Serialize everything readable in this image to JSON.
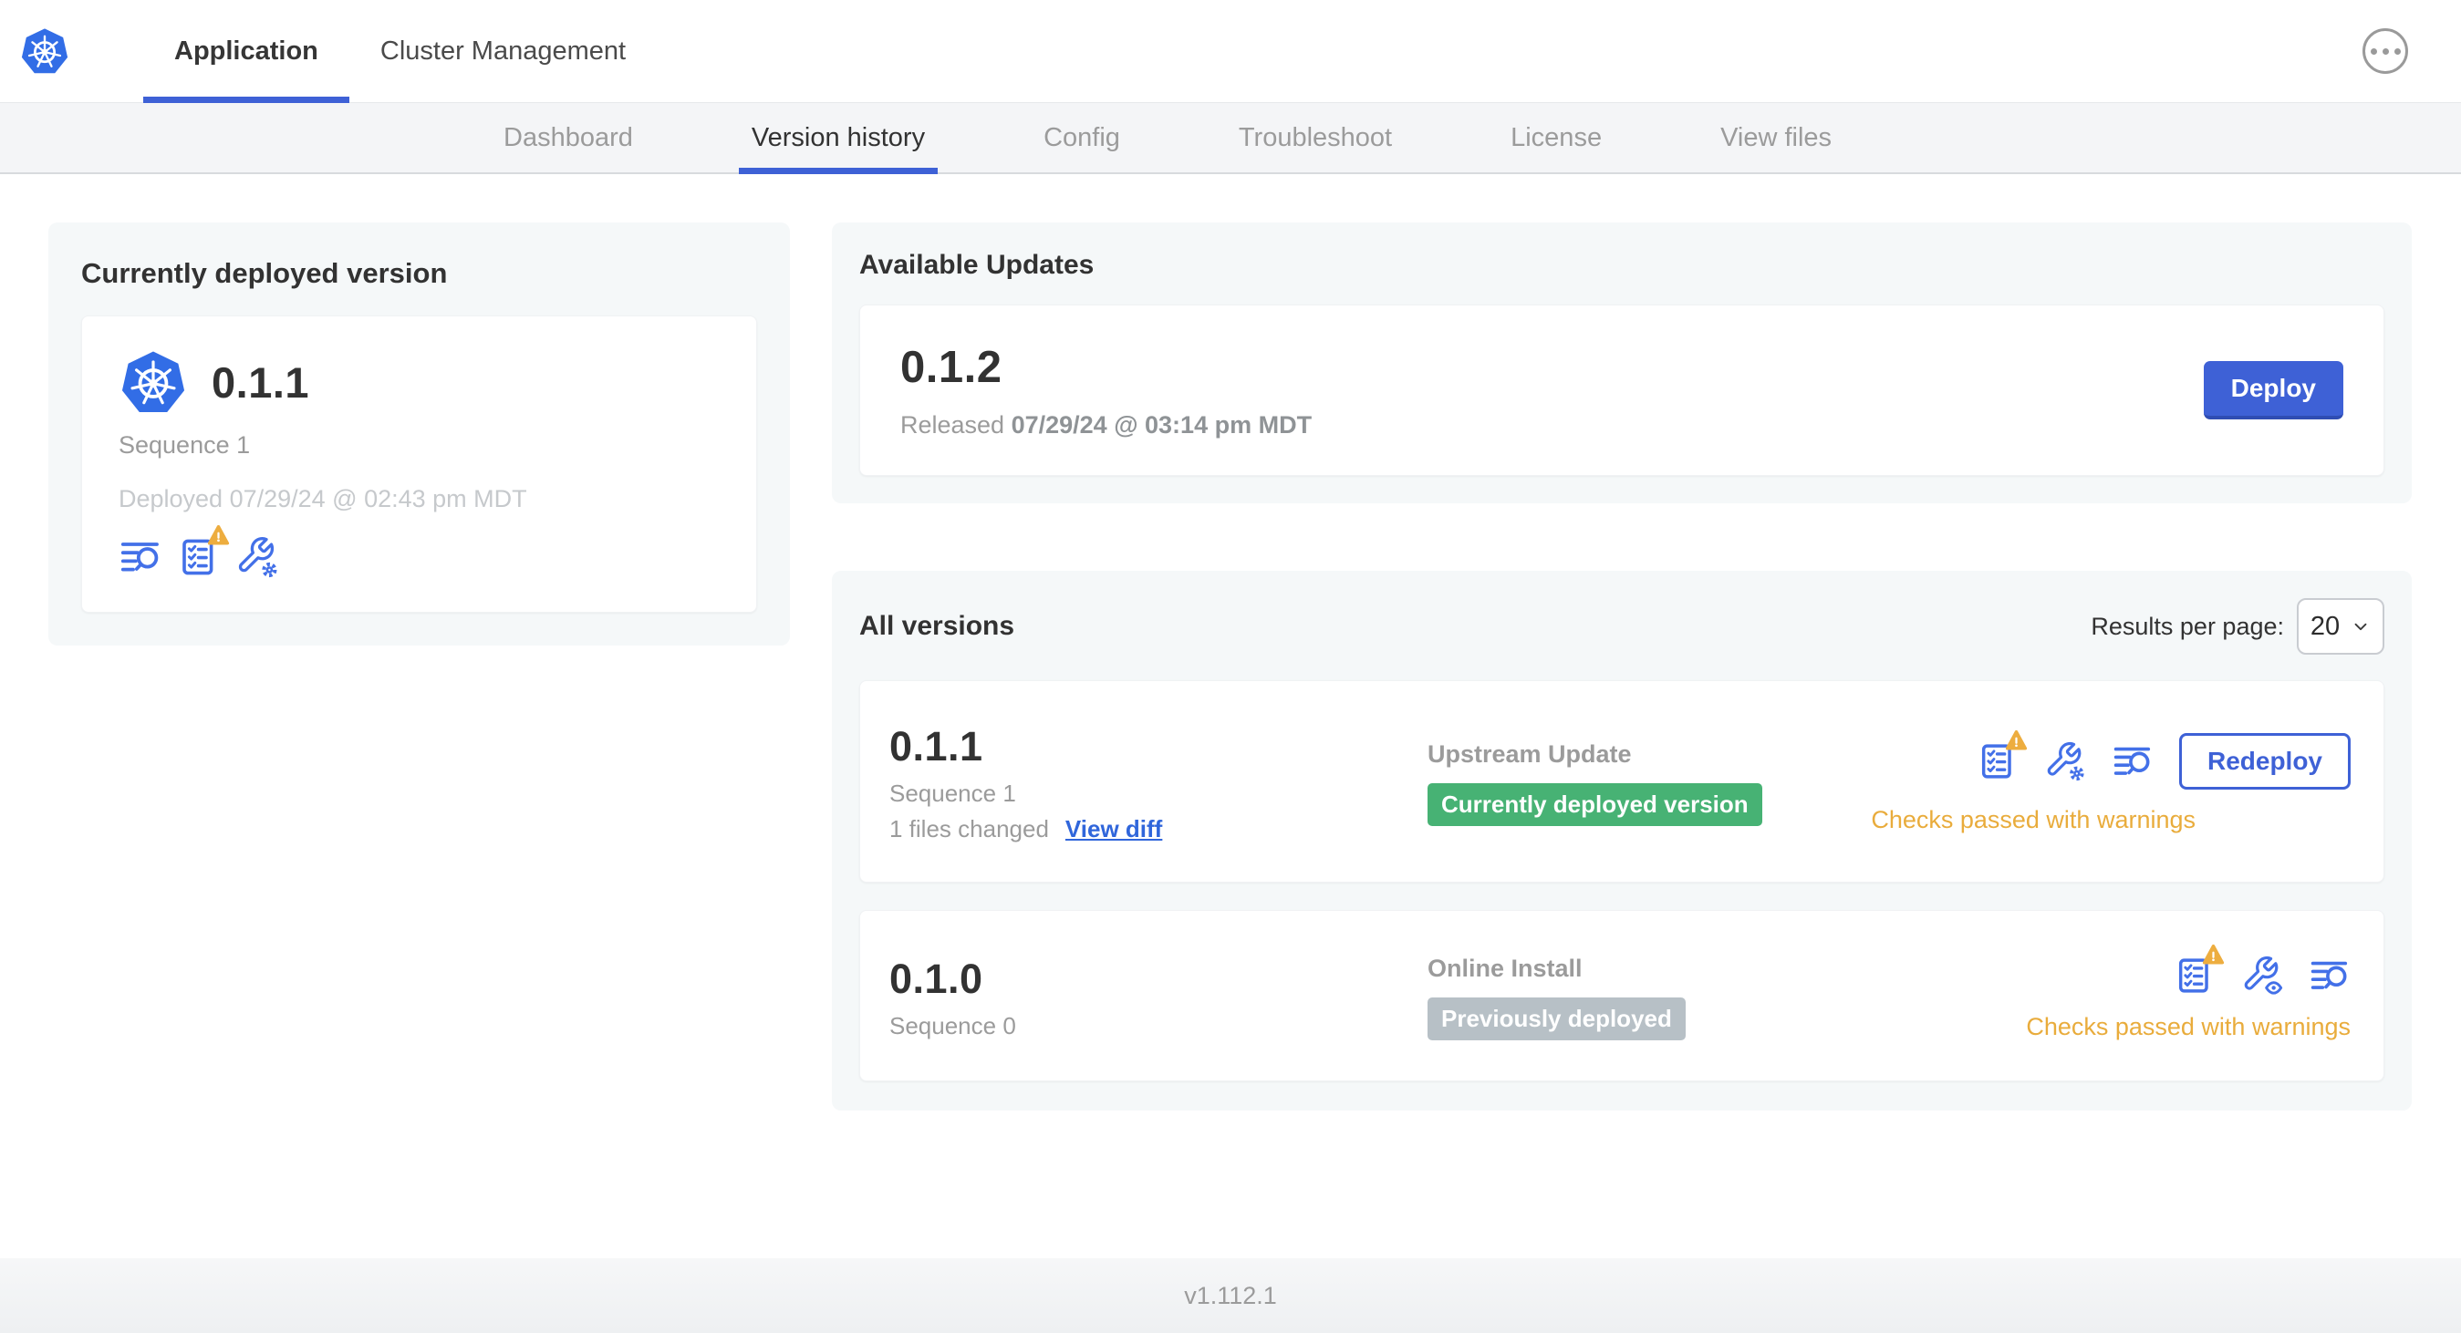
{
  "colors": {
    "kubernetes_blue": "#326DE6",
    "accent_blue": "#3E61D6",
    "icon_blue": "#4370E8",
    "link_blue": "#3066DB",
    "success_green": "#47B274",
    "muted_badge_gray": "#B7C0C6",
    "warning_orange": "#E9AC3C",
    "text_dark": "#323232",
    "text_gray": "#9B9B9B",
    "text_light_gray": "#C6C9CC"
  },
  "header": {
    "logo_icon": "kubernetes-logo",
    "tabs": [
      {
        "label": "Application",
        "active": true
      },
      {
        "label": "Cluster Management",
        "active": false
      }
    ],
    "more_icon": "ellipsis-icon"
  },
  "subnav": {
    "items": [
      {
        "label": "Dashboard",
        "active": false
      },
      {
        "label": "Version history",
        "active": true
      },
      {
        "label": "Config",
        "active": false
      },
      {
        "label": "Troubleshoot",
        "active": false
      },
      {
        "label": "License",
        "active": false
      },
      {
        "label": "View files",
        "active": false
      }
    ]
  },
  "current_version": {
    "title": "Currently deployed version",
    "version": "0.1.1",
    "sequence": "Sequence 1",
    "deployed": "Deployed 07/29/24 @ 02:43 pm MDT",
    "icons": [
      "text-search-icon",
      "checklist-warning-icon",
      "wrench-gear-icon"
    ]
  },
  "available_updates": {
    "title": "Available Updates",
    "version": "0.1.2",
    "released_label": "Released",
    "released_date": "07/29/24 @ 03:14 pm MDT",
    "deploy_label": "Deploy"
  },
  "all_versions": {
    "title": "All versions",
    "results_per_page_label": "Results per page:",
    "results_per_page_value": "20",
    "rows": [
      {
        "version": "0.1.1",
        "sequence": "Sequence 1",
        "files_changed": "1 files changed",
        "view_diff_label": "View diff",
        "source": "Upstream Update",
        "badge_label": "Currently deployed version",
        "badge_color": "green",
        "status": "Checks passed with warnings",
        "action_label": "Redeploy",
        "icons": [
          "checklist-warning-icon",
          "wrench-gear-icon",
          "text-search-icon"
        ]
      },
      {
        "version": "0.1.0",
        "sequence": "Sequence 0",
        "source": "Online Install",
        "badge_label": "Previously deployed",
        "badge_color": "gray",
        "status": "Checks passed with warnings",
        "icons": [
          "checklist-warning-icon",
          "wrench-eye-icon",
          "text-search-icon"
        ]
      }
    ]
  },
  "footer": {
    "app_version": "v1.112.1"
  }
}
